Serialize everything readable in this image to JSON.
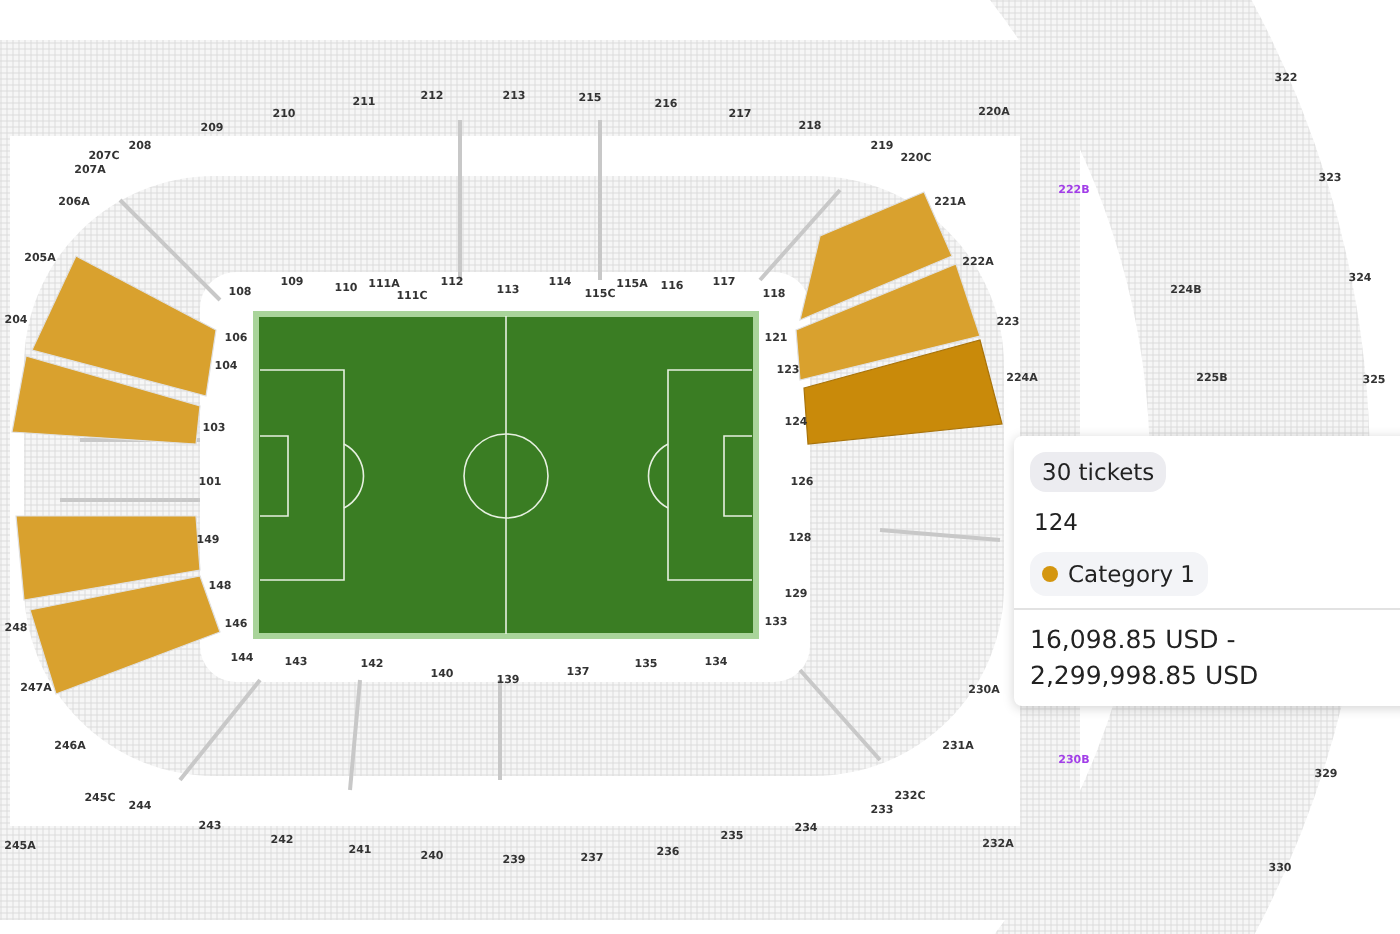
{
  "lower_sections": [
    {
      "label": "108",
      "available": false,
      "selected": false
    },
    {
      "label": "109",
      "available": false,
      "selected": false
    },
    {
      "label": "110",
      "available": false,
      "selected": false
    },
    {
      "label": "111A",
      "available": false,
      "selected": false
    },
    {
      "label": "111C",
      "available": false,
      "selected": false
    },
    {
      "label": "112",
      "available": false,
      "selected": false
    },
    {
      "label": "113",
      "available": false,
      "selected": false
    },
    {
      "label": "114",
      "available": false,
      "selected": false
    },
    {
      "label": "115C",
      "available": false,
      "selected": false
    },
    {
      "label": "115A",
      "available": false,
      "selected": false
    },
    {
      "label": "116",
      "available": false,
      "selected": false
    },
    {
      "label": "117",
      "available": false,
      "selected": false
    },
    {
      "label": "118",
      "available": false,
      "selected": false
    },
    {
      "label": "106",
      "available": false,
      "selected": false
    },
    {
      "label": "121",
      "available": true,
      "selected": false
    },
    {
      "label": "104",
      "available": true,
      "selected": false
    },
    {
      "label": "123",
      "available": true,
      "selected": false
    },
    {
      "label": "103",
      "available": true,
      "selected": false
    },
    {
      "label": "124",
      "available": true,
      "selected": true
    },
    {
      "label": "101",
      "available": false,
      "selected": false
    },
    {
      "label": "126",
      "available": false,
      "selected": false
    },
    {
      "label": "149",
      "available": true,
      "selected": false
    },
    {
      "label": "128",
      "available": false,
      "selected": false
    },
    {
      "label": "148",
      "available": true,
      "selected": false
    },
    {
      "label": "129",
      "available": false,
      "selected": false
    },
    {
      "label": "146",
      "available": false,
      "selected": false
    },
    {
      "label": "133",
      "available": false,
      "selected": false
    },
    {
      "label": "144",
      "available": false,
      "selected": false
    },
    {
      "label": "143",
      "available": false,
      "selected": false
    },
    {
      "label": "142",
      "available": false,
      "selected": false
    },
    {
      "label": "140",
      "available": false,
      "selected": false
    },
    {
      "label": "139",
      "available": false,
      "selected": false
    },
    {
      "label": "137",
      "available": false,
      "selected": false
    },
    {
      "label": "135",
      "available": false,
      "selected": false
    },
    {
      "label": "134",
      "available": false,
      "selected": false
    }
  ],
  "upper_sections": [
    {
      "label": "207C",
      "marked": false
    },
    {
      "label": "207A",
      "marked": false
    },
    {
      "label": "208",
      "marked": false
    },
    {
      "label": "209",
      "marked": false
    },
    {
      "label": "210",
      "marked": false
    },
    {
      "label": "211",
      "marked": false
    },
    {
      "label": "212",
      "marked": false
    },
    {
      "label": "213",
      "marked": false
    },
    {
      "label": "215",
      "marked": false
    },
    {
      "label": "216",
      "marked": false
    },
    {
      "label": "217",
      "marked": false
    },
    {
      "label": "218",
      "marked": false
    },
    {
      "label": "219",
      "marked": false
    },
    {
      "label": "220C",
      "marked": false
    },
    {
      "label": "220A",
      "marked": false
    },
    {
      "label": "222B",
      "marked": true
    },
    {
      "label": "221A",
      "marked": false
    },
    {
      "label": "222A",
      "marked": false
    },
    {
      "label": "223",
      "marked": false
    },
    {
      "label": "224A",
      "marked": false
    },
    {
      "label": "224B",
      "marked": false
    },
    {
      "label": "225B",
      "marked": false
    },
    {
      "label": "322",
      "marked": false
    },
    {
      "label": "323",
      "marked": false
    },
    {
      "label": "324",
      "marked": false
    },
    {
      "label": "325",
      "marked": false
    },
    {
      "label": "206A",
      "marked": false
    },
    {
      "label": "205A",
      "marked": false
    },
    {
      "label": "204",
      "marked": false
    },
    {
      "label": "248",
      "marked": false
    },
    {
      "label": "247A",
      "marked": false
    },
    {
      "label": "246A",
      "marked": false
    },
    {
      "label": "245C",
      "marked": false
    },
    {
      "label": "245A",
      "marked": false
    },
    {
      "label": "244",
      "marked": false
    },
    {
      "label": "243",
      "marked": false
    },
    {
      "label": "242",
      "marked": false
    },
    {
      "label": "241",
      "marked": false
    },
    {
      "label": "240",
      "marked": false
    },
    {
      "label": "239",
      "marked": false
    },
    {
      "label": "237",
      "marked": false
    },
    {
      "label": "236",
      "marked": false
    },
    {
      "label": "235",
      "marked": false
    },
    {
      "label": "234",
      "marked": false
    },
    {
      "label": "233",
      "marked": false
    },
    {
      "label": "232C",
      "marked": false
    },
    {
      "label": "232A",
      "marked": false
    },
    {
      "label": "231A",
      "marked": false
    },
    {
      "label": "230B",
      "marked": true
    },
    {
      "label": "230A",
      "marked": false
    },
    {
      "label": "329",
      "marked": false
    },
    {
      "label": "330",
      "marked": false
    }
  ],
  "tooltip": {
    "count": "30 tickets",
    "section": "124",
    "category": {
      "label": "Category 1",
      "color": "#d4960f"
    },
    "price": "16,098.85 USD - 2,299,998.85 USD"
  }
}
